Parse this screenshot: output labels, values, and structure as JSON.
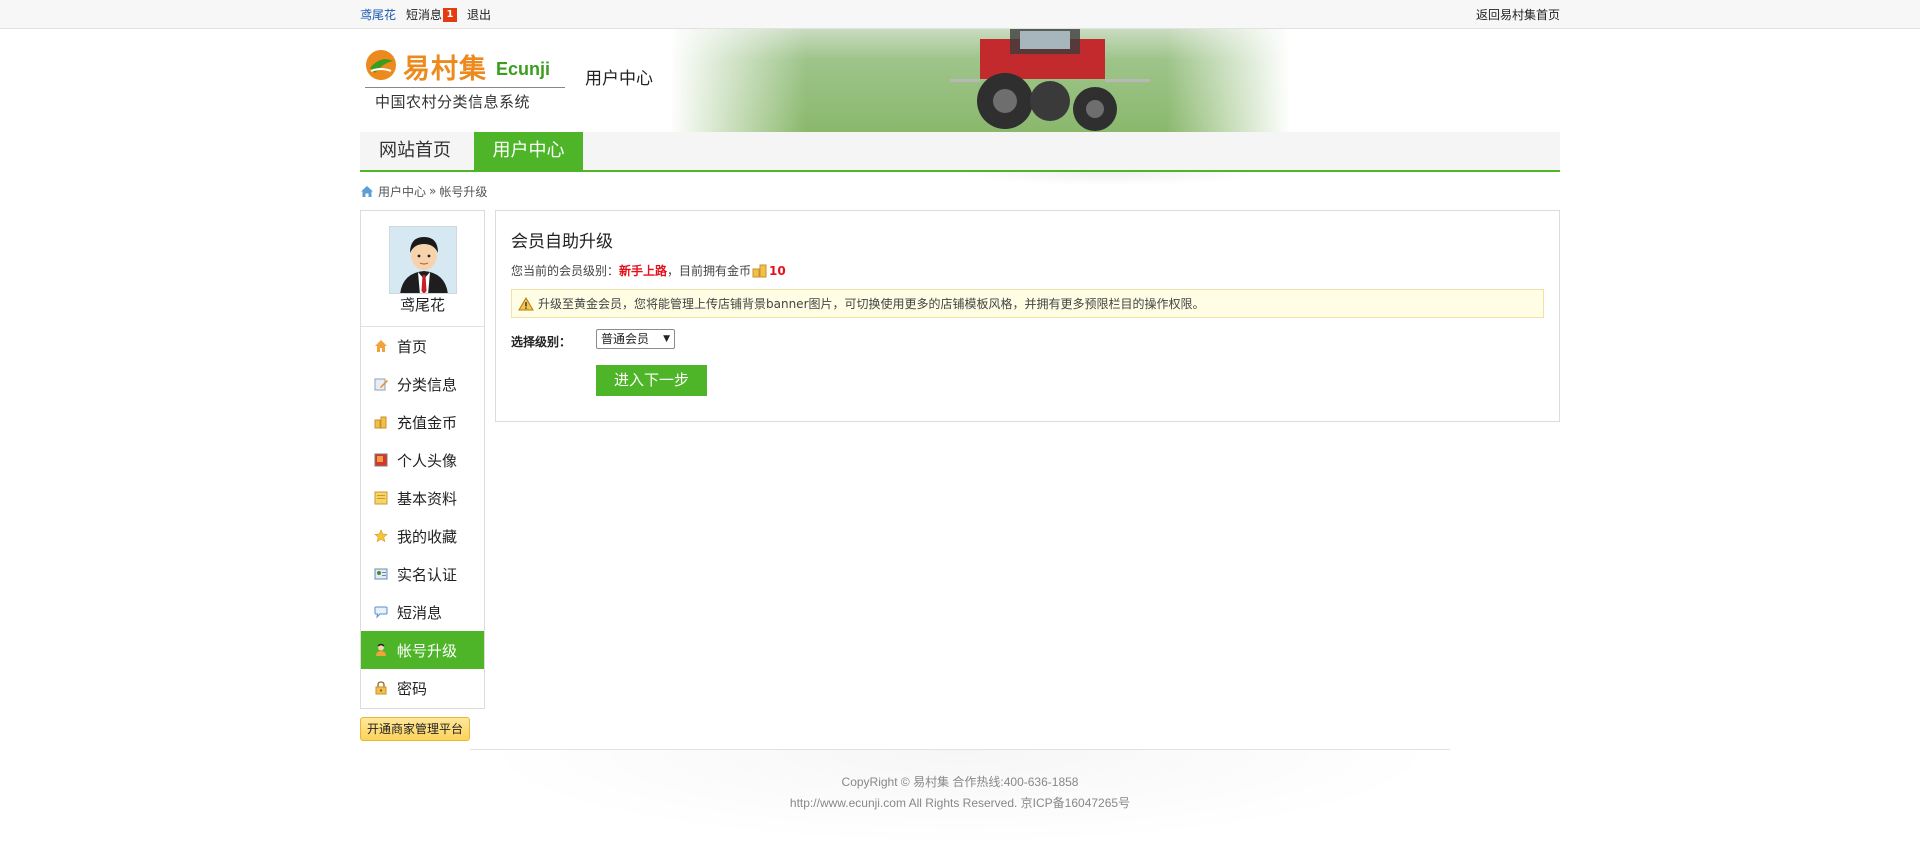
{
  "topbar": {
    "username": "鸢尾花",
    "messages_label": "短消息",
    "messages_count": "1",
    "logout_label": "退出",
    "home_link": "返回易村集首页"
  },
  "header": {
    "logo_cn": "易村集",
    "logo_en": "Ecunji",
    "logo_sub": "中国农村分类信息系统",
    "section_title": "用户中心"
  },
  "nav": {
    "items": [
      {
        "label": "网站首页",
        "active": false
      },
      {
        "label": "用户中心",
        "active": true
      }
    ]
  },
  "breadcrumb": {
    "root": "用户中心",
    "separator": "»",
    "current": "帐号升级"
  },
  "sidebar": {
    "username": "鸢尾花",
    "menu": [
      {
        "label": "首页",
        "icon": "house-icon"
      },
      {
        "label": "分类信息",
        "icon": "edit-note-icon"
      },
      {
        "label": "充值金币",
        "icon": "coins-icon"
      },
      {
        "label": "个人头像",
        "icon": "picture-icon"
      },
      {
        "label": "基本资料",
        "icon": "notepad-icon"
      },
      {
        "label": "我的收藏",
        "icon": "star-icon"
      },
      {
        "label": "实名认证",
        "icon": "id-card-icon"
      },
      {
        "label": "短消息",
        "icon": "chat-bubble-icon"
      },
      {
        "label": "帐号升级",
        "icon": "user-upgrade-icon",
        "active": true
      },
      {
        "label": "密码",
        "icon": "lock-icon"
      }
    ],
    "merchant_button": "开通商家管理平台"
  },
  "main": {
    "title": "会员自助升级",
    "level_prefix": "您当前的会员级别：",
    "level_value": "新手上路",
    "coins_prefix": "，目前拥有金币",
    "coins_value": "10",
    "notice": "升级至黄金会员，您将能管理上传店铺背景banner图片，可切换使用更多的店铺模板风格，并拥有更多预限栏目的操作权限。",
    "select_label": "选择级别：",
    "select_value": "普通会员",
    "next_button": "进入下一步"
  },
  "footer": {
    "line1": "CopyRight © 易村集 合作热线:400-636-1858",
    "line2": "http://www.ecunji.com All Rights Reserved. 京ICP备16047265号"
  },
  "colors": {
    "brand_green": "#4eb528",
    "accent_red": "#e4111b",
    "logo_orange": "#ec8a1e",
    "link_blue": "#1a56b0"
  }
}
